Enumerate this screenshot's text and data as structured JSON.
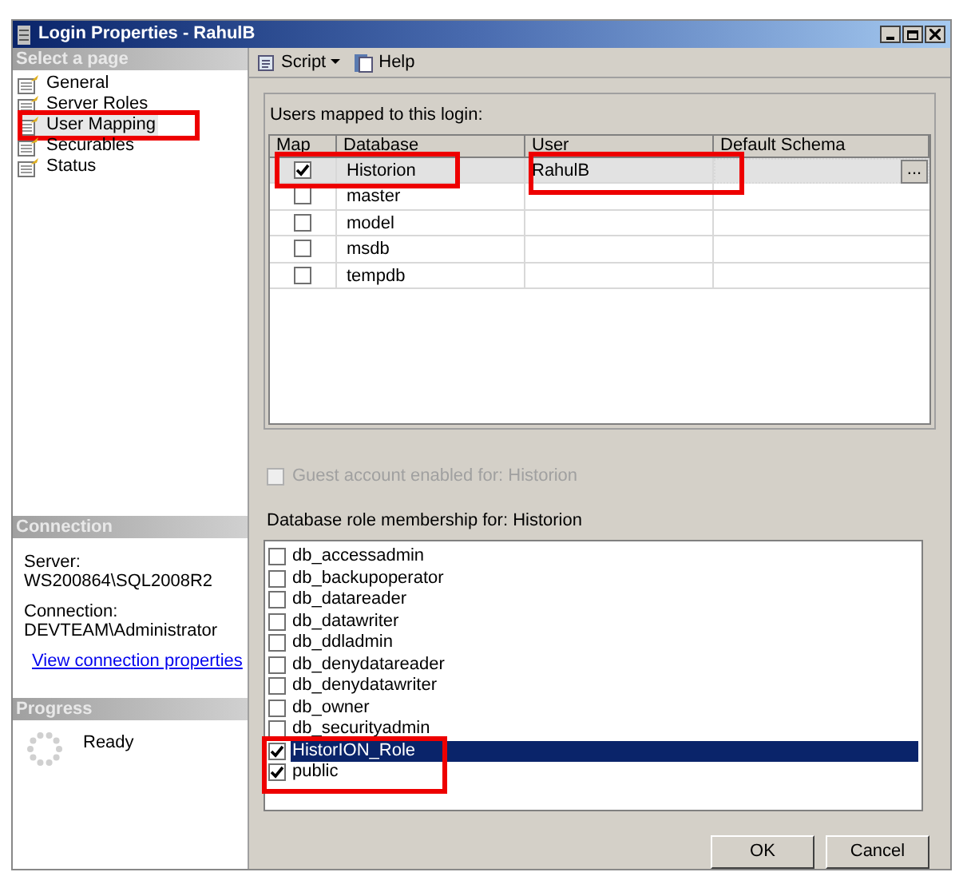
{
  "window": {
    "title": "Login Properties - RahulB"
  },
  "select_page": {
    "header": "Select a page",
    "items": [
      {
        "label": "General",
        "selected": false,
        "highlighted": false
      },
      {
        "label": "Server Roles",
        "selected": false,
        "highlighted": false
      },
      {
        "label": "User Mapping",
        "selected": true,
        "highlighted": true
      },
      {
        "label": "Securables",
        "selected": false,
        "highlighted": false
      },
      {
        "label": "Status",
        "selected": false,
        "highlighted": false
      }
    ]
  },
  "connection": {
    "header": "Connection",
    "server_label": "Server:",
    "server": "WS200864\\SQL2008R2",
    "connection_label": "Connection:",
    "connection": "DEVTEAM\\Administrator",
    "link": "View connection properties"
  },
  "progress": {
    "header": "Progress",
    "status": "Ready"
  },
  "toolbar": {
    "script": "Script",
    "help": "Help"
  },
  "users_mapped": {
    "label": "Users mapped to this login:",
    "columns": [
      "Map",
      "Database",
      "User",
      "Default Schema"
    ],
    "browse_button": "...",
    "rows": [
      {
        "checked": true,
        "database": "Historion",
        "user": "RahulB",
        "selected": true,
        "highlighted": true
      },
      {
        "checked": false,
        "database": "master",
        "user": "",
        "selected": false,
        "highlighted": false
      },
      {
        "checked": false,
        "database": "model",
        "user": "",
        "selected": false,
        "highlighted": false
      },
      {
        "checked": false,
        "database": "msdb",
        "user": "",
        "selected": false,
        "highlighted": false
      },
      {
        "checked": false,
        "database": "tempdb",
        "user": "",
        "selected": false,
        "highlighted": false
      }
    ]
  },
  "guest": {
    "label": "Guest account enabled for: Historion",
    "checked": false,
    "disabled": true
  },
  "roles": {
    "label": "Database role membership for: Historion",
    "items": [
      {
        "label": "db_accessadmin",
        "checked": false,
        "selected": false,
        "highlighted": false
      },
      {
        "label": "db_backupoperator",
        "checked": false,
        "selected": false,
        "highlighted": false
      },
      {
        "label": "db_datareader",
        "checked": false,
        "selected": false,
        "highlighted": false
      },
      {
        "label": "db_datawriter",
        "checked": false,
        "selected": false,
        "highlighted": false
      },
      {
        "label": "db_ddladmin",
        "checked": false,
        "selected": false,
        "highlighted": false
      },
      {
        "label": "db_denydatareader",
        "checked": false,
        "selected": false,
        "highlighted": false
      },
      {
        "label": "db_denydatawriter",
        "checked": false,
        "selected": false,
        "highlighted": false
      },
      {
        "label": "db_owner",
        "checked": false,
        "selected": false,
        "highlighted": false
      },
      {
        "label": "db_securityadmin",
        "checked": false,
        "selected": false,
        "highlighted": false
      },
      {
        "label": "HistorION_Role",
        "checked": true,
        "selected": true,
        "highlighted": true
      },
      {
        "label": "public",
        "checked": true,
        "selected": false,
        "highlighted": true
      }
    ]
  },
  "buttons": [
    "OK",
    "Cancel"
  ]
}
